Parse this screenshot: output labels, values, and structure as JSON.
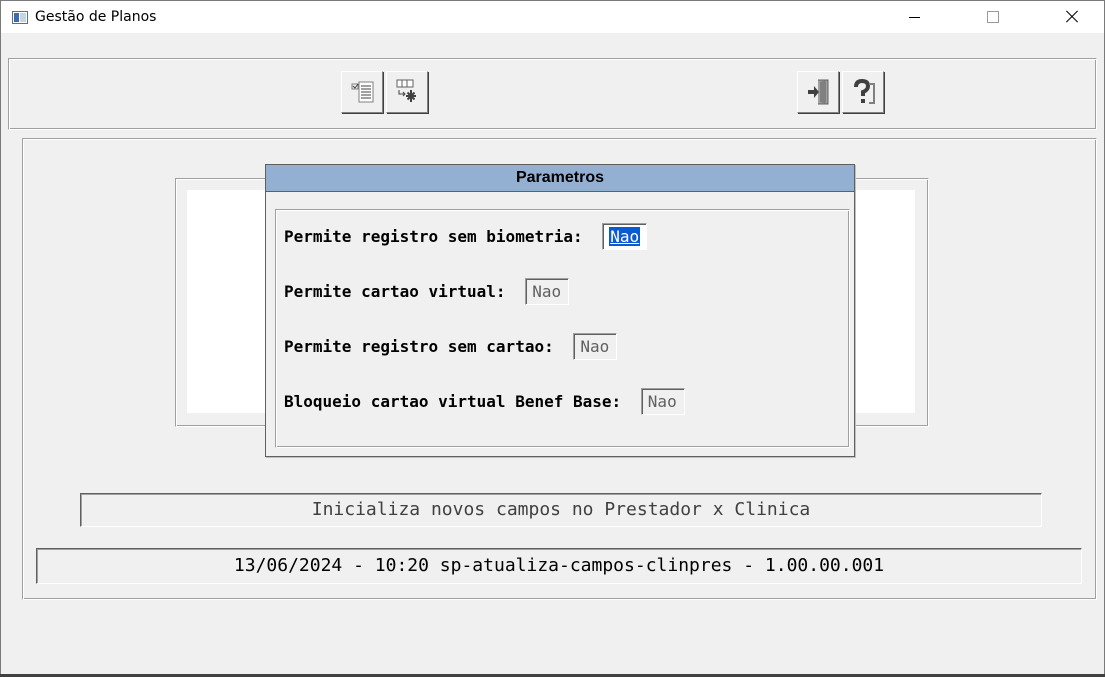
{
  "window": {
    "title": "Gestão de Planos",
    "app_icon": "window-app-icon",
    "controls": [
      "minimize-icon",
      "maximize-icon",
      "close-icon"
    ]
  },
  "toolbar": {
    "buttons": [
      {
        "name": "checklist-icon"
      },
      {
        "name": "process-table-icon"
      },
      {
        "name": "exit-door-icon"
      },
      {
        "name": "help-icon"
      }
    ]
  },
  "dialog": {
    "title": "Parametros",
    "title_color": "#93b0d3",
    "params": [
      {
        "label": "Permite registro sem biometria:",
        "value": "Nao"
      },
      {
        "label": "Permite cartao virtual:",
        "value": "Nao"
      },
      {
        "label": "Permite registro sem cartao:",
        "value": "Nao"
      },
      {
        "label": "Bloqueio cartao virtual Benef Base:",
        "value": "Nao"
      }
    ]
  },
  "status": {
    "message": "Inicializa novos campos no Prestador x Clinica",
    "info": "13/06/2024 - 10:20  sp-atualiza-campos-clinpres - 1.00.00.001"
  },
  "colors": {
    "selection": "#0a5bd3",
    "background": "#f0f0f0"
  }
}
